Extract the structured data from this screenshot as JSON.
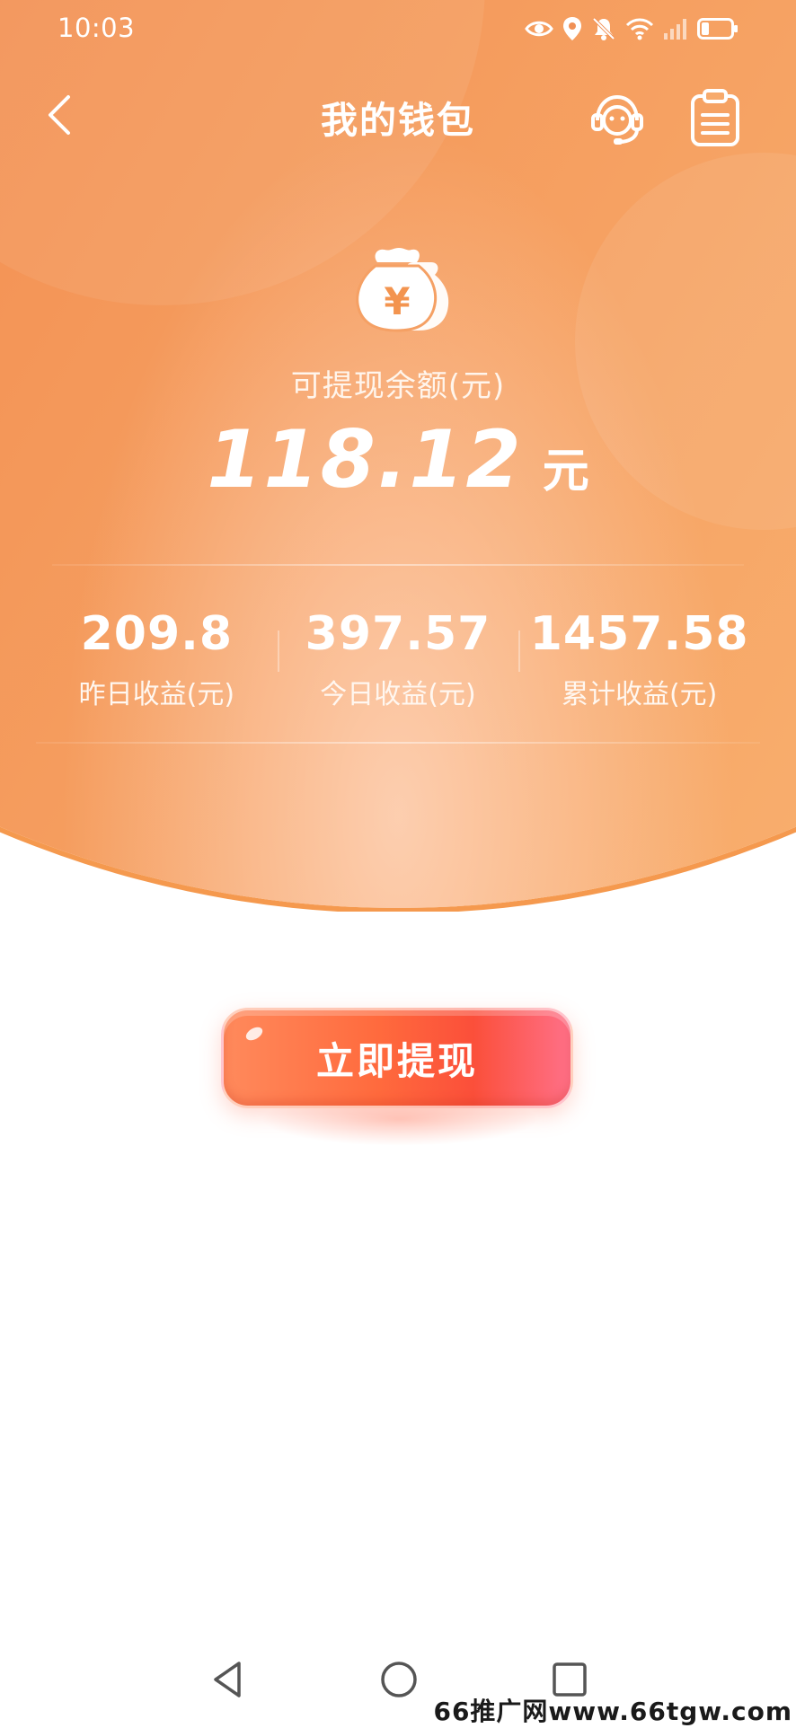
{
  "status_bar": {
    "time": "10:03",
    "icons": [
      "eye-icon",
      "location-icon",
      "bell-mute-icon",
      "wifi-icon",
      "signal-icon",
      "battery-icon"
    ]
  },
  "header": {
    "title": "我的钱包",
    "back_icon": "chevron-left-icon",
    "service_icon": "customer-service-icon",
    "records_icon": "clipboard-icon"
  },
  "balance": {
    "icon": "money-bag-icon",
    "label": "可提现余额(元)",
    "amount": "118.12",
    "unit": "元"
  },
  "stats": [
    {
      "value": "209.8",
      "label": "昨日收益(元)"
    },
    {
      "value": "397.57",
      "label": "今日收益(元)"
    },
    {
      "value": "1457.58",
      "label": "累计收益(元)"
    }
  ],
  "withdraw_button": {
    "label": "立即提现"
  },
  "system_nav": {
    "icons": [
      "triangle-back-icon",
      "circle-home-icon",
      "square-recent-icon"
    ]
  },
  "watermark": "66推广网www.66tgw.com",
  "colors": {
    "header_gradient_start": "#e8783f",
    "header_gradient_end": "#fbbd7a",
    "button_gradient_start": "#ff8a5c",
    "button_gradient_end": "#ff7088"
  }
}
